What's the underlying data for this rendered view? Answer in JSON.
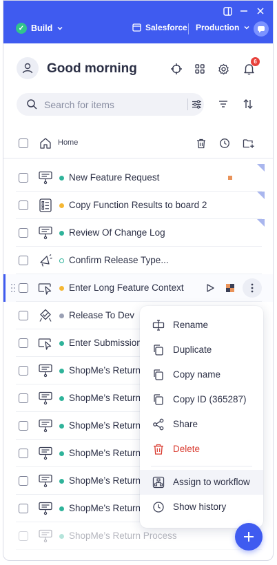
{
  "topbar": {
    "build_label": "Build",
    "system_label": "Salesforce",
    "env_label": "Production"
  },
  "header": {
    "greeting": "Good morning",
    "notification_count": "6"
  },
  "search": {
    "placeholder": "Search for items",
    "value": ""
  },
  "breadcrumb": {
    "home_label": "Home"
  },
  "colors": {
    "brand": "#3f5bf0",
    "status_green": "#2fb39a",
    "status_amber": "#f5b733",
    "status_grey": "#9aa0b4",
    "delete_red": "#d93a2f"
  },
  "list": {
    "items": [
      {
        "label": "New Feature Request",
        "icon": "smart-tip-icon",
        "status": "green"
      },
      {
        "label": "Copy Function Results to board 2",
        "icon": "checklist-icon",
        "status": "amber"
      },
      {
        "label": "Review Of Change Log",
        "icon": "smart-tip-icon",
        "status": "green"
      },
      {
        "label": "Confirm Release Type...",
        "icon": "megaphone-icon",
        "status": "hollow"
      },
      {
        "label": "Enter Long Feature Context",
        "icon": "walkthru-icon",
        "status": "amber"
      },
      {
        "label": "Release To Dev",
        "icon": "launcher-icon",
        "status": "grey"
      },
      {
        "label": "Enter Submission",
        "icon": "walkthru-icon",
        "status": "green"
      },
      {
        "label": "ShopMe’s Return",
        "icon": "smart-tip-icon",
        "status": "green"
      },
      {
        "label": "ShopMe’s Return",
        "icon": "smart-tip-icon",
        "status": "green"
      },
      {
        "label": "ShopMe’s Return",
        "icon": "smart-tip-icon",
        "status": "green"
      },
      {
        "label": "ShopMe’s Return",
        "icon": "smart-tip-icon",
        "status": "green"
      },
      {
        "label": "ShopMe’s Return",
        "icon": "smart-tip-icon",
        "status": "green"
      },
      {
        "label": "ShopMe’s Return",
        "icon": "smart-tip-icon",
        "status": "green"
      },
      {
        "label": "ShopMe’s Return Process",
        "icon": "smart-tip-icon",
        "status": "green"
      }
    ]
  },
  "context_menu": {
    "rename": "Rename",
    "duplicate": "Duplicate",
    "copy_name": "Copy name",
    "copy_id": "Copy ID (365287)",
    "share": "Share",
    "delete": "Delete",
    "assign": "Assign to workflow",
    "history": "Show history"
  }
}
